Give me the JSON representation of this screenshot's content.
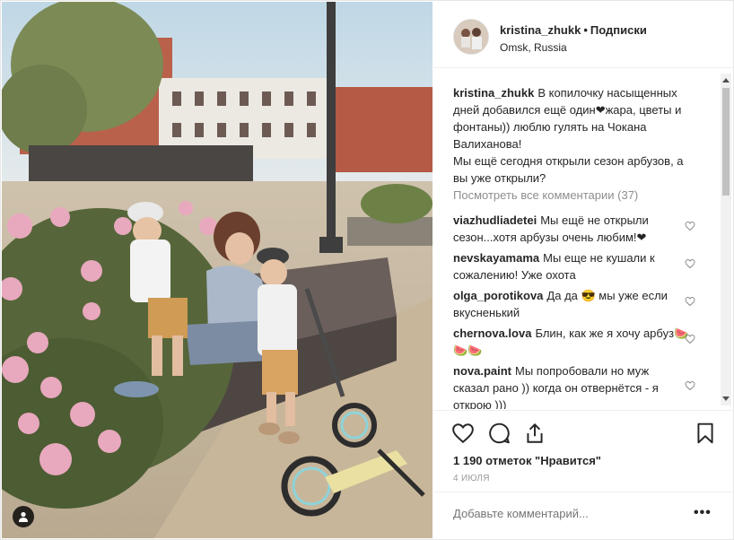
{
  "post": {
    "username": "kristina_zhukk",
    "dot": "•",
    "follow_label": "Подписки",
    "location": "Omsk, Russia",
    "caption_text": "В копилочку насыщенных дней добавился ещё один❤жара, цветы и фонтаны)) люблю гулять на Чокана Валиханова!\nМы ещё сегодня открыли сезон арбузов, а вы уже открыли?",
    "view_all_comments": "Посмотреть все комментарии (37)",
    "comments": [
      {
        "user": "viazhudliadetei",
        "text": "Мы ещё не открыли сезон...хотя арбузы очень любим!❤"
      },
      {
        "user": "nevskayamama",
        "text": "Мы еще не кушали к сожалению! Уже охота"
      },
      {
        "user": "olga_porotikova",
        "text": "Да да 😎 мы уже если вкусненький"
      },
      {
        "user": "chernova.lova",
        "text": "Блин, как же я хочу арбуз🍉🍉🍉"
      },
      {
        "user": "nova.paint",
        "text": "Мы попробовали но муж сказал рано )) когда он отвернётся - я открою )))"
      }
    ],
    "likes_text": "1 190 отметок \"Нравится\"",
    "date_text": "4 ИЮЛЯ",
    "add_comment_placeholder": "Добавьте комментарий...",
    "more_label": "•••"
  },
  "icons": {
    "like": "heart-icon",
    "comment": "comment-icon",
    "share": "share-icon",
    "save": "bookmark-icon",
    "tagged": "user-tag-icon"
  },
  "colors": {
    "text": "#262626",
    "muted": "#8e8e8e",
    "border": "#efefef"
  }
}
